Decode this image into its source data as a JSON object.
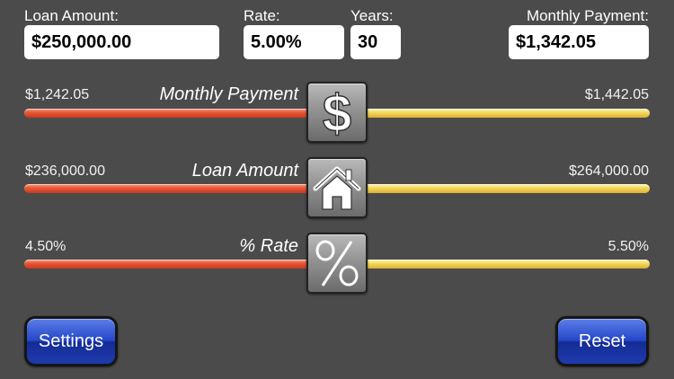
{
  "header": {
    "loan_amount": {
      "label": "Loan Amount:",
      "value": "$250,000.00"
    },
    "rate": {
      "label": "Rate:",
      "value": "5.00%"
    },
    "years": {
      "label": "Years:",
      "value": "30"
    },
    "monthly_payment": {
      "label": "Monthly Payment:",
      "value": "$1,342.05"
    }
  },
  "sliders": {
    "payment": {
      "title": "Monthly Payment",
      "min_label": "$1,242.05",
      "max_label": "$1,442.05",
      "level": 0.5,
      "icon": "dollar-sign-icon"
    },
    "loan": {
      "title": "Loan Amount",
      "min_label": "$236,000.00",
      "max_label": "$264,000.00",
      "level": 0.5,
      "icon": "house-icon"
    },
    "rate": {
      "title": "% Rate",
      "min_label": "4.50%",
      "max_label": "5.50%",
      "level": 0.5,
      "icon": "percent-icon"
    }
  },
  "buttons": {
    "settings": "Settings",
    "reset": "Reset"
  },
  "colors": {
    "background": "#4b4b4b",
    "track_left": "#e04a2a",
    "track_right": "#f1d04e",
    "button_blue": "#2547c9"
  }
}
